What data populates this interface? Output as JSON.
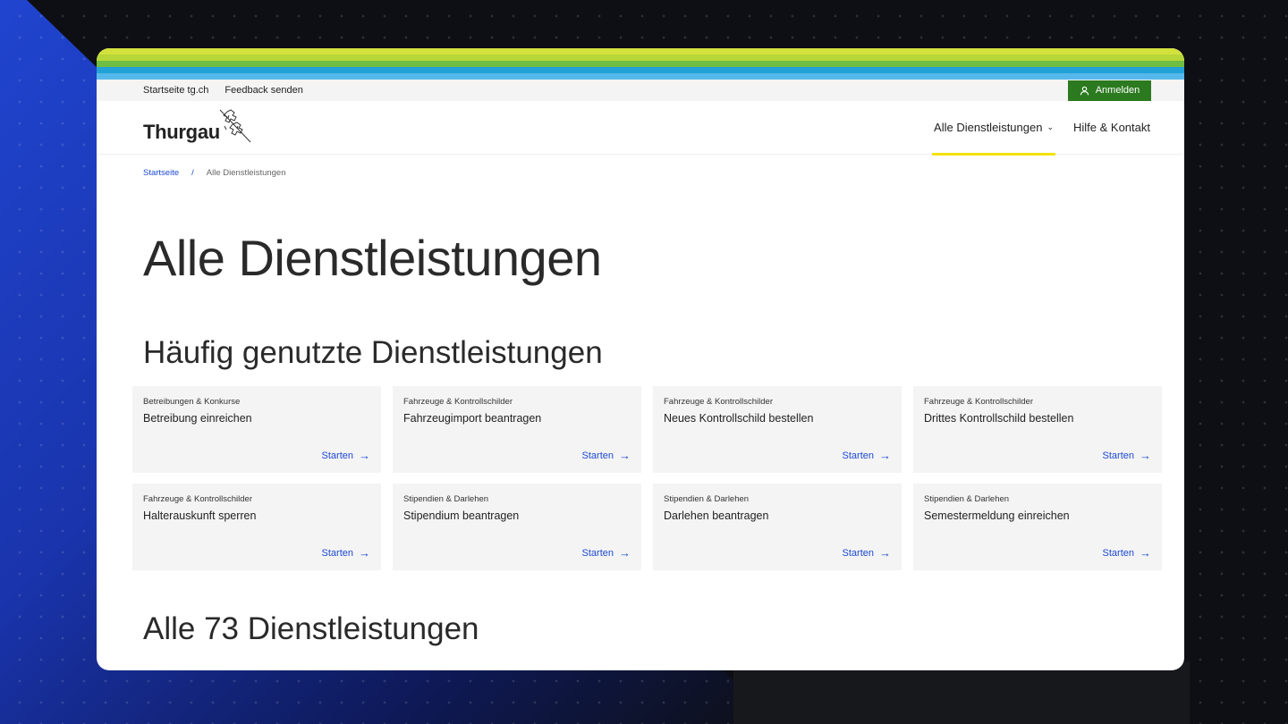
{
  "topbar": {
    "links": [
      "Startseite tg.ch",
      "Feedback senden"
    ],
    "login_label": "Anmelden"
  },
  "header": {
    "logo_text": "Thurgau",
    "nav": [
      {
        "label": "Alle Dienstleistungen",
        "has_dropdown": true,
        "active": true
      },
      {
        "label": "Hilfe & Kontakt",
        "has_dropdown": false,
        "active": false
      }
    ]
  },
  "breadcrumb": {
    "home": "Startseite",
    "separator": "/",
    "current": "Alle Dienstleistungen"
  },
  "page_title": "Alle Dienstleistungen",
  "frequent": {
    "title": "Häufig genutzte Dienstleistungen",
    "cards": [
      {
        "category": "Betreibungen & Konkurse",
        "title": "Betreibung einreichen",
        "action": "Starten"
      },
      {
        "category": "Fahrzeuge & Kontrollschilder",
        "title": "Fahrzeugimport beantragen",
        "action": "Starten"
      },
      {
        "category": "Fahrzeuge & Kontrollschilder",
        "title": "Neues Kontrollschild bestellen",
        "action": "Starten"
      },
      {
        "category": "Fahrzeuge & Kontrollschilder",
        "title": "Drittes Kontrollschild bestellen",
        "action": "Starten"
      },
      {
        "category": "Fahrzeuge & Kontrollschilder",
        "title": "Halterauskunft sperren",
        "action": "Starten"
      },
      {
        "category": "Stipendien & Darlehen",
        "title": "Stipendium beantragen",
        "action": "Starten"
      },
      {
        "category": "Stipendien & Darlehen",
        "title": "Darlehen beantragen",
        "action": "Starten"
      },
      {
        "category": "Stipendien & Darlehen",
        "title": "Semestermeldung einreichen",
        "action": "Starten"
      }
    ]
  },
  "all_title": "Alle 73 Dienstleistungen",
  "icons": {
    "login": "user-icon",
    "dropdown": "chevron-down-icon",
    "card_action": "arrow-right-icon",
    "logo": "thurgau-lions-logo"
  },
  "colors": {
    "accent_blue": "#1d4ad1",
    "login_green": "#2b7a1f",
    "nav_underline": "#f2e20d",
    "stripes": [
      "#d3e13d",
      "#b7d637",
      "#6fbd43",
      "#22a1d8",
      "#56b8ea"
    ]
  }
}
